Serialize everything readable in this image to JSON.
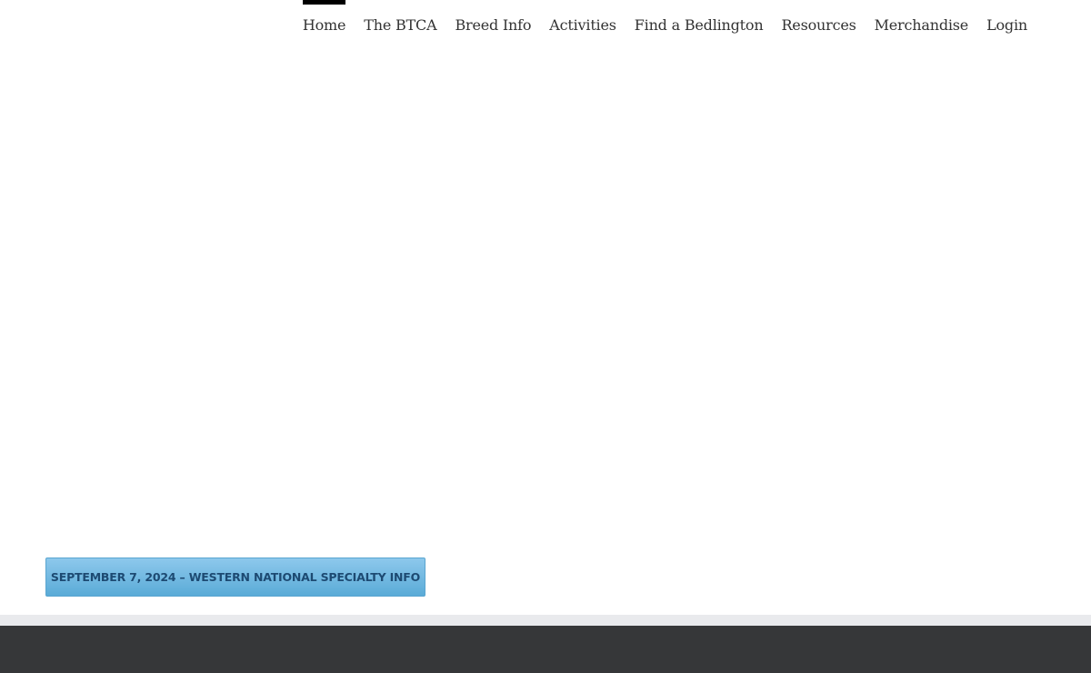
{
  "header": {
    "logo_icon": "club-seal-logo",
    "nav": [
      {
        "label": "Home",
        "active": true
      },
      {
        "label": "The BTCA"
      },
      {
        "label": "Breed Info"
      },
      {
        "label": "Activities"
      },
      {
        "label": "Find a Bedlington"
      },
      {
        "label": "Resources"
      },
      {
        "label": "Merchandise"
      },
      {
        "label": "Login"
      }
    ]
  },
  "hero": {
    "cta_label": "SEPTEMBER 7, 2024 – WESTERN NATIONAL SPECIALTY INFO"
  },
  "colors": {
    "cta_gradient_top": "#8dc8ec",
    "cta_gradient_bottom": "#5aabd7",
    "cta_text": "#1d4a72",
    "nav_active_bar": "#000000",
    "footer_bg": "#363739",
    "footer_divider": "#e9eaed"
  }
}
